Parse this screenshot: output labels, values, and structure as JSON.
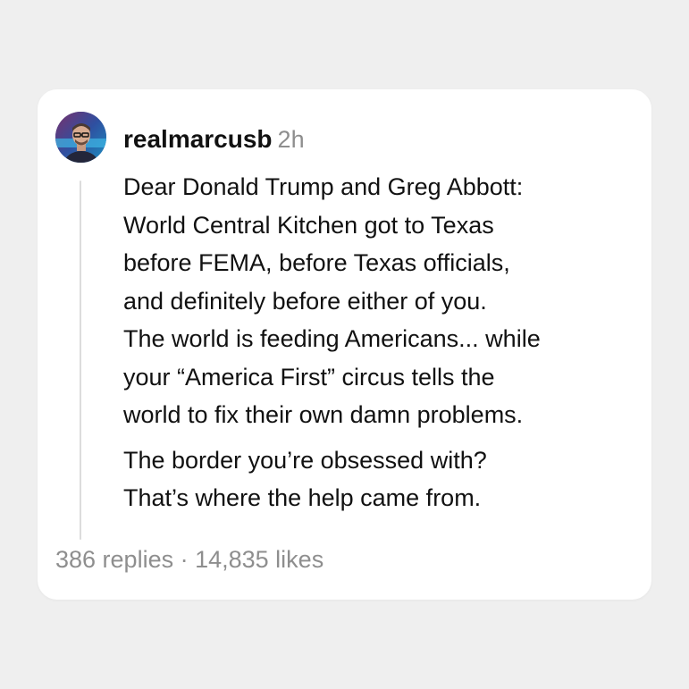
{
  "post": {
    "username": "realmarcusb",
    "time": "2h",
    "paragraphs": [
      "Dear Donald Trump and Greg Abbott:\nWorld Central Kitchen got to Texas\nbefore FEMA, before Texas officials,\nand definitely before either of you.\nThe world is feeding Americans... while\nyour “America First” circus tells the\nworld to fix their own damn problems.",
      "The border you’re obsessed with?\nThat’s where the help came from."
    ],
    "replies": "386 replies",
    "separator": " · ",
    "likes": "14,835 likes"
  }
}
